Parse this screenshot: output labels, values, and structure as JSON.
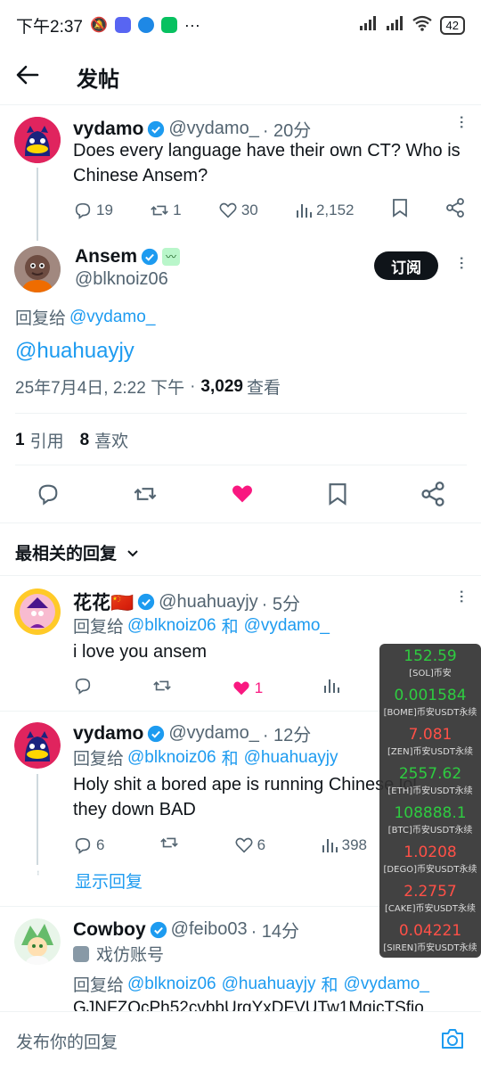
{
  "status": {
    "time": "下午2:37",
    "dots": "···",
    "battery": "42",
    "signal1": "R",
    "signal2": "R"
  },
  "header": {
    "title": "发帖"
  },
  "parent_tweet": {
    "name": "vydamo",
    "handle": "@vydamo_",
    "time": "· 20分",
    "text": "Does every language have their own CT? Who is Chinese Ansem?",
    "replies": "19",
    "retweets": "1",
    "likes": "30",
    "views": "2,152"
  },
  "main_tweet": {
    "name": "Ansem",
    "handle": "@blknoiz06",
    "follow_label": "订阅",
    "reply_prefix": "回复给",
    "reply_to": "@vydamo_",
    "text": "@huahuayjy",
    "date": "25年7月4日, 2:22 下午",
    "dot": "·",
    "views": "3,029",
    "views_label": "查看",
    "quotes_count": "1",
    "quotes_label": "引用",
    "likes_count": "8",
    "likes_label": "喜欢"
  },
  "replies_section": {
    "sort_label": "最相关的回复"
  },
  "reply1": {
    "name": "花花🇨🇳",
    "handle": "@huahuayjy",
    "time": "· 5分",
    "reply_prefix": "回复给",
    "reply_to_1": "@blknoiz06",
    "and": "和",
    "reply_to_2": "@vydamo_",
    "text": "i love you ansem",
    "likes": "1"
  },
  "reply2": {
    "name": "vydamo",
    "handle": "@vydamo_",
    "time": "· 12分",
    "reply_prefix": "回复给",
    "reply_to_1": "@blknoiz06",
    "and": "和",
    "reply_to_2": "@huahuayjy",
    "text": "Holy shit a bored ape is running Chinese lol they down BAD",
    "replies": "6",
    "likes": "6",
    "views": "398",
    "show_replies": "显示回复"
  },
  "reply3": {
    "name": "Cowboy",
    "handle": "@feibo03",
    "time": "· 14分",
    "parody_label": "戏仿账号",
    "reply_prefix": "回复给",
    "reply_to_1": "@blknoiz06",
    "reply_to_2": "@huahuayjy",
    "and": "和",
    "reply_to_3": "@vydamo_",
    "text_partial": "GJNFZQcPh52cvbbUrgYxDFVUTw1MgjcTSfio"
  },
  "ticker": [
    {
      "price": "152.59",
      "label": "[SOL]币安",
      "dir": "up"
    },
    {
      "price": "0.001584",
      "label": "[BOME]币安USDT永续",
      "dir": "up"
    },
    {
      "price": "7.081",
      "label": "[ZEN]币安USDT永续",
      "dir": "down"
    },
    {
      "price": "2557.62",
      "label": "[ETH]币安USDT永续",
      "dir": "up"
    },
    {
      "price": "108888.1",
      "label": "[BTC]币安USDT永续",
      "dir": "up"
    },
    {
      "price": "1.0208",
      "label": "[DEGO]币安USDT永续",
      "dir": "down"
    },
    {
      "price": "2.2757",
      "label": "[CAKE]币安USDT永续",
      "dir": "down"
    },
    {
      "price": "0.04221",
      "label": "[SIREN]币安USDT永续",
      "dir": "down"
    }
  ],
  "compose": {
    "placeholder": "发布你的回复"
  },
  "colors": {
    "accent": "#1d9bf0",
    "like": "#f91880",
    "up": "#2ecc40",
    "down": "#ff5047"
  }
}
